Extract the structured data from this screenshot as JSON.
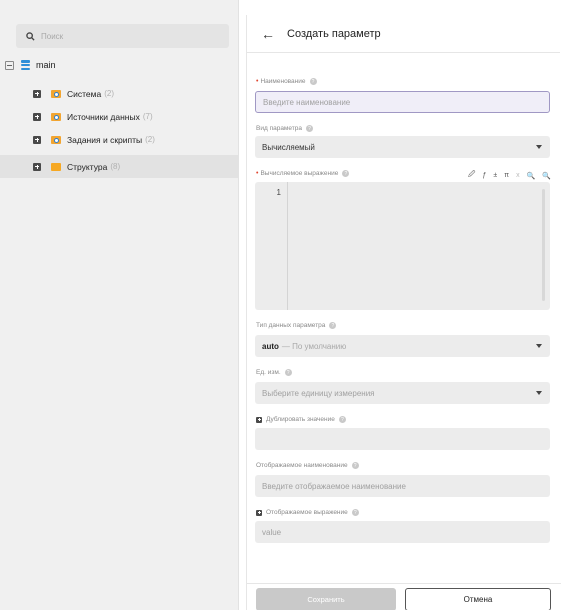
{
  "sidebar": {
    "search_placeholder": "Поиск",
    "root_label": "main",
    "items": [
      {
        "label": "Система",
        "count": "(2)"
      },
      {
        "label": "Источники данных",
        "count": "(7)"
      },
      {
        "label": "Задания и скрипты",
        "count": "(2)"
      },
      {
        "label": "Структура",
        "count": "(8)"
      }
    ]
  },
  "form": {
    "back_glyph": "←",
    "title": "Создать параметр",
    "name_label": "Наименование",
    "name_placeholder": "Введите наименование",
    "type_label": "Вид параметра",
    "type_value": "Вычисляемый",
    "expression_label": "Вычисляемое выражение",
    "toolbar": [
      "🖉",
      "ƒ",
      "±",
      "π",
      "x",
      "🔍",
      "🔍"
    ],
    "editor_line": "1",
    "datatype_label": "Тип данных параметра",
    "datatype_value": "auto",
    "datatype_hint": "— По умолчанию",
    "unit_label": "Ед. изм.",
    "unit_placeholder": "Выберите единицу измерения",
    "duplicate_label": "Дублировать значение",
    "display_name_label": "Отображаемое наименование",
    "display_name_placeholder": "Введите отображаемое наименование",
    "display_expr_label": "Отображаемое выражение",
    "display_expr_placeholder": "value",
    "save_label": "Сохранить",
    "cancel_label": "Отмена",
    "help_glyph": "?"
  },
  "colors": {
    "accent": "#2f8fd8",
    "folder": "#f2a531",
    "required": "#e0452f"
  }
}
